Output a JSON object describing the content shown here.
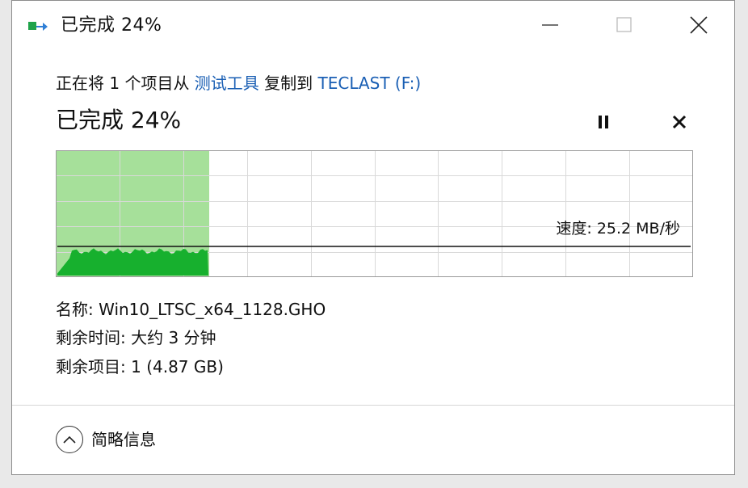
{
  "window": {
    "title": "已完成 24%",
    "controls": {
      "minimize_icon": "minimize-icon",
      "maximize_icon": "maximize-icon",
      "close_icon": "close-icon"
    }
  },
  "copy": {
    "prefix": "正在将 1 个项目从 ",
    "source": "测试工具",
    "middle": " 复制到 ",
    "destination": "TECLAST (F:)",
    "status": "已完成 24%",
    "progress": 0.24,
    "speed_label": "速度: 25.2 MB/秒"
  },
  "details": {
    "name_label": "名称:",
    "name_value": "Win10_LTSC_x64_1128.GHO",
    "time_label": "剩余时间:",
    "time_value": "大约 3 分钟",
    "items_label": "剩余项目:",
    "items_value": "1 (4.87 GB)"
  },
  "footer": {
    "toggle_label": "简略信息"
  },
  "colors": {
    "accent_link": "#1a5fb4",
    "progress_fill": "#a6e09a",
    "speed_area": "#17b02e",
    "grid_line": "#d9d9d9"
  }
}
